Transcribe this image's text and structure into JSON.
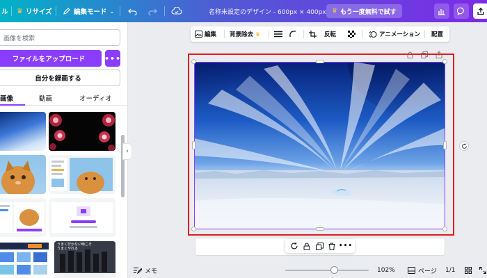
{
  "header": {
    "left_label": "ル",
    "resize_label": "リサイズ",
    "edit_mode_label": "編集モード",
    "design_title": "名称未設定のデザイン - 600px × 400px",
    "try_again_label": "もう一度無料で試す"
  },
  "panel": {
    "search_placeholder": "画像を検索",
    "upload_label": "ファイルをアップロード",
    "record_label": "自分を録画する",
    "tabs": [
      {
        "label": "画像"
      },
      {
        "label": "動画"
      },
      {
        "label": "オーディオ"
      }
    ],
    "thumb_text": {
      "catchphrase": "うまく行かない時こそ\nうまくやれる"
    }
  },
  "toolbar": {
    "edit_label": "編集",
    "bg_remove_label": "背景除去",
    "flip_label": "反転",
    "animation_label": "アニメーション",
    "position_label": "配置"
  },
  "bottom": {
    "notes_label": "メモ",
    "zoom_value": "102%",
    "pages_label": "ページ",
    "page_count": "1/1"
  },
  "colors": {
    "accent": "#8b3dff",
    "highlight": "#e31b1b"
  }
}
